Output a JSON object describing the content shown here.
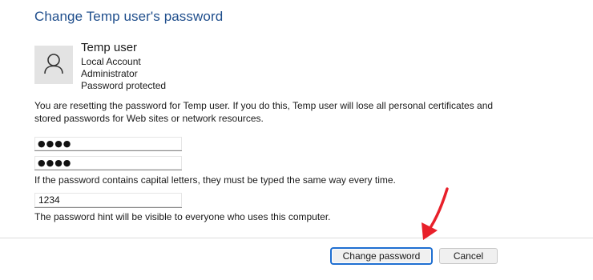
{
  "dialog": {
    "title": "Change Temp user's password"
  },
  "account": {
    "avatar_icon": "user-avatar-icon",
    "name": "Temp user",
    "type": "Local Account",
    "role": "Administrator",
    "status": "Password protected"
  },
  "message": {
    "warning": "You are resetting the password for Temp user.  If you do this, Temp user will lose all personal certificates and stored passwords for Web sites or network resources."
  },
  "form": {
    "new_password_value": "●●●●",
    "confirm_password_value": "●●●●",
    "capital_letters_note": "If the password contains capital letters, they must be typed the same way every time.",
    "hint_value": "1234",
    "hint_note": "The password hint will be visible to everyone who uses this computer."
  },
  "buttons": {
    "change_password_label": "Change password",
    "cancel_label": "Cancel"
  },
  "annotation": {
    "arrow_color": "#e8202a",
    "arrow_icon": "red-pointer-arrow"
  }
}
